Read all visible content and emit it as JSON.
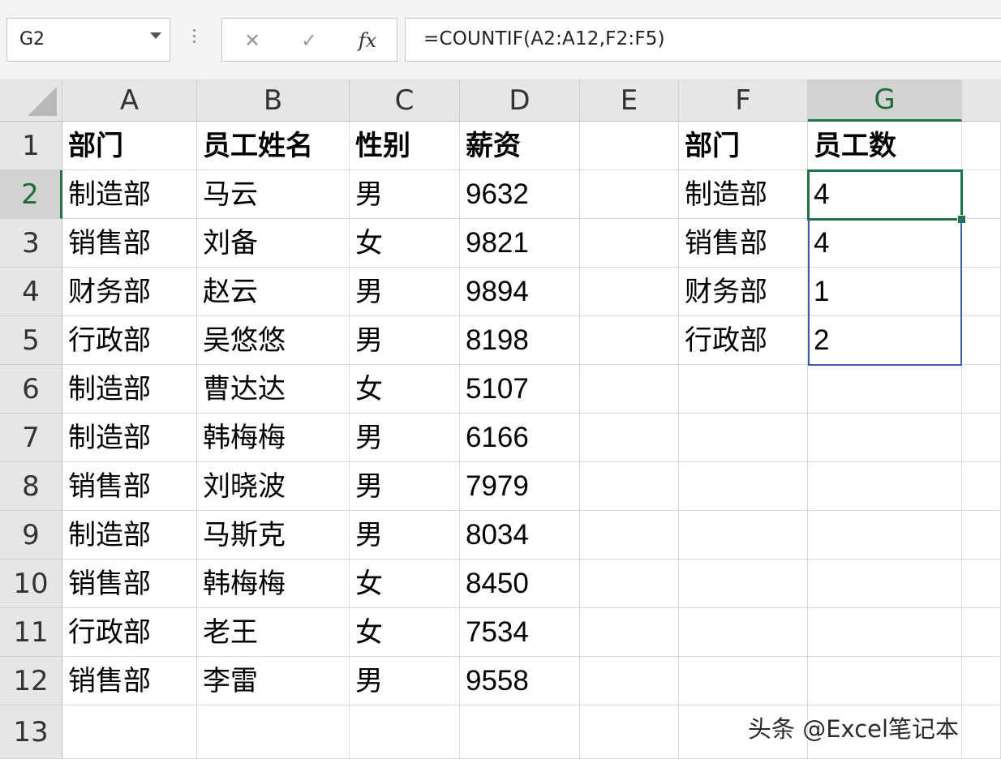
{
  "formula_bar": {
    "name_box": "G2",
    "cancel_icon": "✕",
    "enter_icon": "✓",
    "fx_label": "fx",
    "formula": "=COUNTIF(A2:A12,F2:F5)"
  },
  "columns": [
    "A",
    "B",
    "C",
    "D",
    "E",
    "F",
    "G"
  ],
  "rows": [
    "1",
    "2",
    "3",
    "4",
    "5",
    "6",
    "7",
    "8",
    "9",
    "10",
    "11",
    "12",
    "13"
  ],
  "selected_cell": "G2",
  "table": {
    "headers": [
      "部门",
      "员工姓名",
      "性别",
      "薪资"
    ],
    "rows": [
      [
        "制造部",
        "马云",
        "男",
        "9632"
      ],
      [
        "销售部",
        "刘备",
        "女",
        "9821"
      ],
      [
        "财务部",
        "赵云",
        "男",
        "9894"
      ],
      [
        "行政部",
        "吴悠悠",
        "男",
        "8198"
      ],
      [
        "制造部",
        "曹达达",
        "女",
        "5107"
      ],
      [
        "制造部",
        "韩梅梅",
        "男",
        "6166"
      ],
      [
        "销售部",
        "刘晓波",
        "男",
        "7979"
      ],
      [
        "制造部",
        "马斯克",
        "男",
        "8034"
      ],
      [
        "销售部",
        "韩梅梅",
        "女",
        "8450"
      ],
      [
        "行政部",
        "老王",
        "女",
        "7534"
      ],
      [
        "销售部",
        "李雷",
        "男",
        "9558"
      ]
    ]
  },
  "summary": {
    "headers": [
      "部门",
      "员工数"
    ],
    "rows": [
      [
        "制造部",
        "4"
      ],
      [
        "销售部",
        "4"
      ],
      [
        "财务部",
        "1"
      ],
      [
        "行政部",
        "2"
      ]
    ]
  },
  "watermark": "头条 @Excel笔记本",
  "colors": {
    "selection": "#217346",
    "range_border": "#3b5fab",
    "header_bg": "#e6e6e6"
  }
}
